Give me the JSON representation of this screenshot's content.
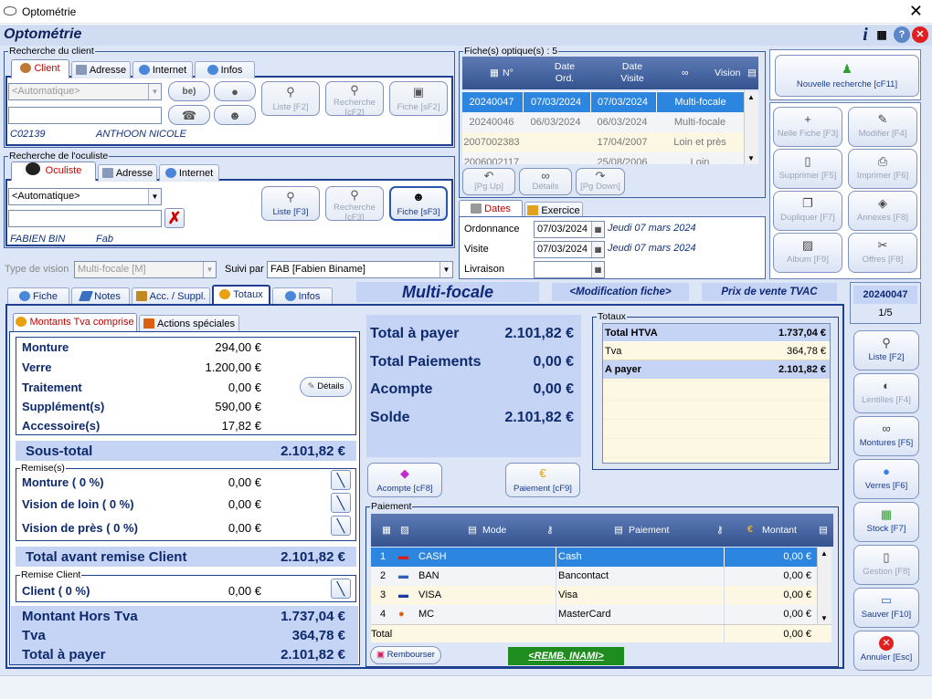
{
  "window": {
    "title": "Optométrie"
  },
  "app": {
    "title": "Optométrie"
  },
  "client": {
    "legend": "Recherche du client",
    "tabs": [
      "Client",
      "Adresse",
      "Internet",
      "Infos"
    ],
    "combo": "<Automatique>",
    "search_value": "",
    "code": "C02139",
    "name": "ANTHOON NICOLE",
    "btn_list": "Liste [F2]",
    "btn_search": "Recherche [cF2]",
    "btn_card": "Fiche [sF2]"
  },
  "oculist": {
    "legend": "Recherche de l'oculiste",
    "tabs": [
      "Oculiste",
      "Adresse",
      "Internet"
    ],
    "combo": "<Automatique>",
    "search_value": "",
    "name": "FABIEN BIN",
    "short": "Fab",
    "btn_list": "Liste [F3]",
    "btn_search": "Recherche [cF3]",
    "btn_card": "Fiche [sF3]"
  },
  "vision": {
    "type_label": "Type de vision",
    "type_value": "Multi-focale [M]",
    "followed_label": "Suivi par",
    "followed_value": "FAB [Fabien Biname]"
  },
  "files": {
    "legend": "Fiche(s) optique(s) : 5",
    "columns": [
      "N°",
      "Date Ord.",
      "Date Visite",
      "Vision"
    ],
    "rows": [
      {
        "n": "20240047",
        "ord": "07/03/2024",
        "visit": "07/03/2024",
        "vision": "Multi-focale"
      },
      {
        "n": "20240046",
        "ord": "06/03/2024",
        "visit": "06/03/2024",
        "vision": "Multi-focale"
      },
      {
        "n": "2007002383",
        "ord": "",
        "visit": "17/04/2007",
        "vision": "Loin et près"
      },
      {
        "n": "2006002117",
        "ord": "",
        "visit": "25/08/2006",
        "vision": "Loin"
      }
    ],
    "btn_pgup": "[Pg Up]",
    "btn_details": "Détails",
    "btn_pgdown": "[Pg Down]"
  },
  "dates": {
    "tabs": [
      "Dates",
      "Exercice"
    ],
    "ordonnance_label": "Ordonnance",
    "ordonnance_value": "07/03/2024",
    "ordonnance_text": "Jeudi 07 mars 2024",
    "visite_label": "Visite",
    "visite_value": "07/03/2024",
    "visite_text": "Jeudi 07 mars 2024",
    "livraison_label": "Livraison",
    "livraison_value": ""
  },
  "right_buttons": [
    "Nouvelle recherche [cF11]",
    "Nelle Fiche [F3]",
    "Modifier [F4]",
    "Supprimer [F5]",
    "Imprimer [F6]",
    "Dupliquer [F7]",
    "Annexes [F8]",
    "Album [F9]",
    "Offres [F8]"
  ],
  "main_tabs": [
    "Fiche",
    "Notes",
    "Acc. / Suppl.",
    "Totaux",
    "Infos"
  ],
  "banner": {
    "type": "Multi-focale",
    "mode": "<Modification fiche>",
    "price": "Prix de vente TVAC",
    "file_no": "20240047",
    "page": "1/5"
  },
  "sub_tabs": [
    "Montants Tva comprise",
    "Actions spéciales"
  ],
  "amounts": {
    "items": [
      {
        "label": "Monture",
        "value": "294,00 €"
      },
      {
        "label": "Verre",
        "value": "1.200,00 €"
      },
      {
        "label": "Traitement",
        "value": "0,00 €"
      },
      {
        "label": "Supplément(s)",
        "value": "590,00 €"
      },
      {
        "label": "Accessoire(s)",
        "value": "17,82 €"
      }
    ],
    "details_btn": "Détails",
    "subtotal_label": "Sous-total",
    "subtotal_value": "2.101,82 €",
    "discounts_legend": "Remise(s)",
    "discounts": [
      {
        "label": "Monture ( 0 %)",
        "value": "0,00 €"
      },
      {
        "label": "Vision de loin ( 0 %)",
        "value": "0,00 €"
      },
      {
        "label": "Vision de près ( 0 %)",
        "value": "0,00 €"
      }
    ],
    "before_label": "Total avant remise Client",
    "before_value": "2.101,82 €",
    "client_legend": "Remise Client",
    "client_label": "Client ( 0 %)",
    "client_value": "0,00 €",
    "ht_label": "Montant Hors Tva",
    "ht_value": "1.737,04 €",
    "tva_label": "Tva",
    "tva_value": "364,78 €",
    "pay_label": "Total à payer",
    "pay_value": "2.101,82 €"
  },
  "summary": [
    {
      "label": "Total à payer",
      "value": "2.101,82 €"
    },
    {
      "label": "Total Paiements",
      "value": "0,00 €"
    },
    {
      "label": "Acompte",
      "value": "0,00 €"
    },
    {
      "label": "Solde",
      "value": "2.101,82 €"
    }
  ],
  "totals": {
    "legend": "Totaux",
    "rows": [
      {
        "label": "Total HTVA",
        "value": "1.737,04 €"
      },
      {
        "label": "Tva",
        "value": "364,78 €"
      },
      {
        "label": "A payer",
        "value": "2.101,82 €"
      }
    ]
  },
  "pay_buttons": {
    "acompte": "Acompte [cF8]",
    "paiement": "Paiement [cF9]"
  },
  "payments": {
    "legend": "Paiement",
    "columns": [
      "Mode",
      "Paiement",
      "Montant"
    ],
    "rows": [
      {
        "n": "1",
        "code": "CASH",
        "name": "Cash",
        "amount": "0,00 €"
      },
      {
        "n": "2",
        "code": "BAN",
        "name": "Bancontact",
        "amount": "0,00 €"
      },
      {
        "n": "3",
        "code": "VISA",
        "name": "Visa",
        "amount": "0,00 €"
      },
      {
        "n": "4",
        "code": "MC",
        "name": "MasterCard",
        "amount": "0,00 €"
      }
    ],
    "total_label": "Total",
    "total_value": "0,00 €",
    "refund_btn": "Rembourser",
    "inami_btn": "<REMB. INAMI>"
  },
  "side_buttons": [
    "Liste [F2]",
    "Lentilles [F4]",
    "Montures [F5]",
    "Verres [F6]",
    "Stock [F7]",
    "Gestion [F8]",
    "Sauver [F10]",
    "Annuler [Esc]"
  ]
}
